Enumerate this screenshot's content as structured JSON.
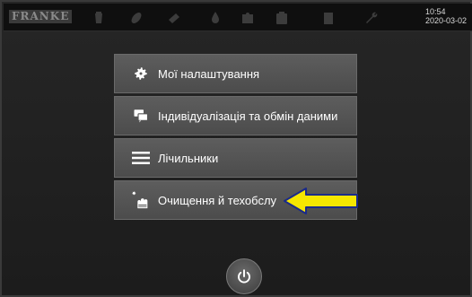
{
  "topbar": {
    "brand": "FRANKE",
    "time": "10:54",
    "date": "2020-03-02",
    "icons": [
      "bean-hopper-icon",
      "leaf-icon",
      "grinder-icon",
      "water-drop-icon",
      "puzzle-icon",
      "service-tablet-icon",
      "book-icon",
      "wrench-icon"
    ]
  },
  "menu": {
    "items": [
      {
        "label": "Мої налаштування",
        "icon": "gear-icon"
      },
      {
        "label": "Індивідуалізація та обмін даними",
        "icon": "chat-bubbles-icon"
      },
      {
        "label": "Лічильники",
        "icon": "hamburger-icon"
      },
      {
        "label": "Очищення й техобслу",
        "icon": "cleaning-hand-icon"
      }
    ]
  },
  "colors": {
    "background": "#1f1f1f",
    "menu_item": "#555555",
    "arrow": "#f5e600",
    "arrow_outline": "#1a2a8a"
  }
}
